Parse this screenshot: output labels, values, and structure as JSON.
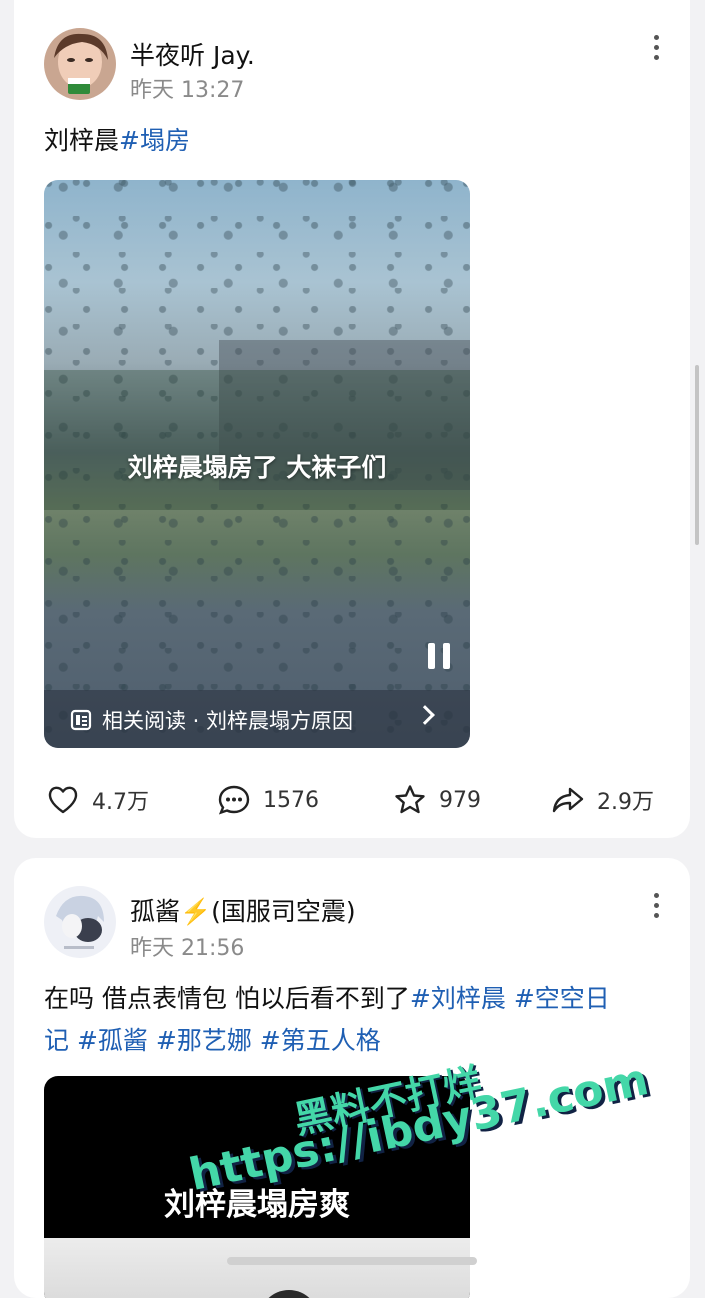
{
  "posts": [
    {
      "username": "半夜听 Jay.",
      "timestamp": "昨天 13:27",
      "text": {
        "plain": "刘梓晨",
        "tags": [
          "#塌房"
        ]
      },
      "media": {
        "caption": "刘梓晨塌房了 大袜子们",
        "related_label": "相关阅读 · 刘梓晨塌方原因",
        "playing": true
      },
      "actions": {
        "likes": "4.7万",
        "comments": "1576",
        "favorites": "979",
        "shares": "2.9万"
      }
    },
    {
      "username": "孤酱⚡️(国服司空震)",
      "timestamp": "昨天 21:56",
      "text": {
        "line1_plain": "在吗 借点表情包 怕以后看不到了",
        "line1_tags": [
          "#刘梓晨",
          "#空空日"
        ],
        "line2_tags_start": "记",
        "line2_tags": [
          "#孤酱",
          "#那艺娜",
          "#第五人格"
        ]
      },
      "media": {
        "caption": "刘梓晨塌房爽"
      }
    }
  ],
  "watermark": {
    "line1": "黑料不打烊",
    "line2": "https://ibdy37.com"
  },
  "colors": {
    "tag": "#1f5fb3",
    "watermark": "#44d7a8",
    "background": "#f2f2f4"
  }
}
